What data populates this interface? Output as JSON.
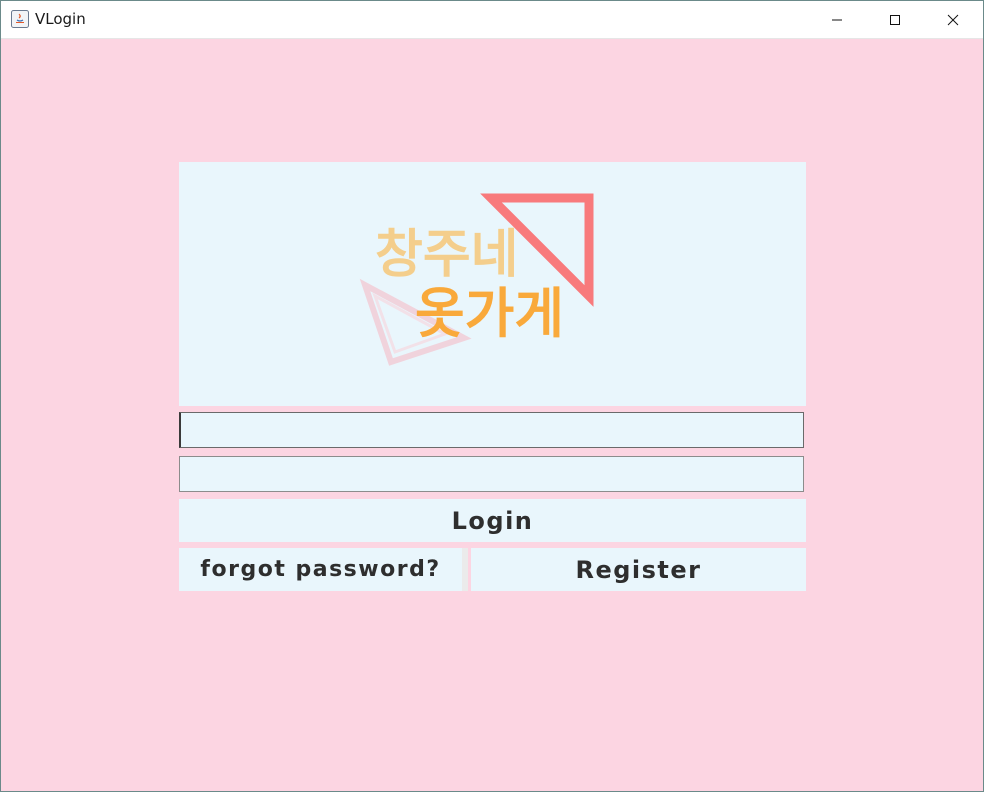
{
  "window": {
    "title": "VLogin",
    "controls": [
      "minimize",
      "maximize",
      "close"
    ]
  },
  "logo": {
    "text_line1": "창주네",
    "text_line2": "옷가게",
    "icon": "pink-triangle-logo"
  },
  "form": {
    "username": {
      "value": "",
      "placeholder": ""
    },
    "password": {
      "value": "",
      "placeholder": ""
    },
    "login_label": "Login",
    "forgot_label": "forgot password?",
    "register_label": "Register"
  },
  "colors": {
    "background": "#fcd5e2",
    "panel": "#e9f6fc",
    "text": "#2e2e2e",
    "logo_red": "#f87a7c",
    "logo_orange": "#f9a93b"
  }
}
